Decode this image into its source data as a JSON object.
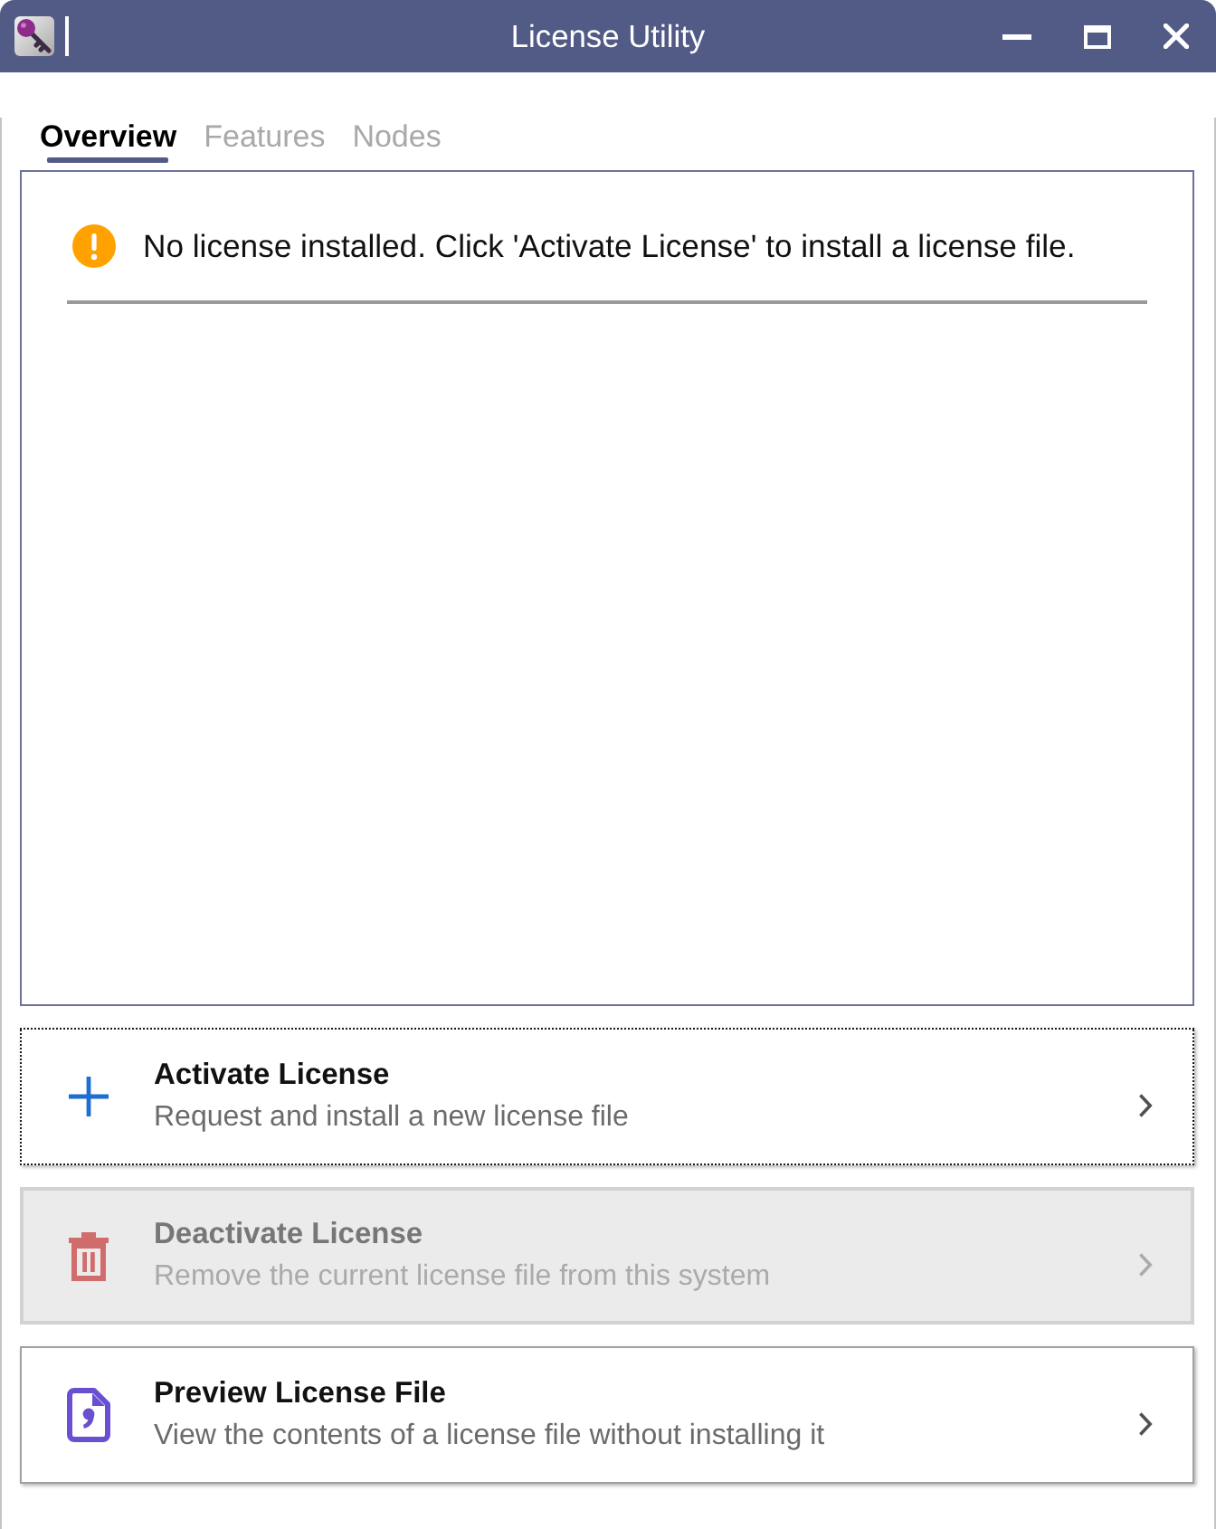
{
  "window": {
    "title": "License Utility"
  },
  "tabs": [
    {
      "label": "Overview",
      "selected": true
    },
    {
      "label": "Features",
      "selected": false
    },
    {
      "label": "Nodes",
      "selected": false
    }
  ],
  "overview": {
    "message": {
      "kind": "warning",
      "text": "No license installed. Click 'Activate License' to install a license file."
    }
  },
  "actions": [
    {
      "kind": "add",
      "title": "Activate License",
      "description": "Request and install a new license file",
      "focused": true,
      "disabled": false
    },
    {
      "kind": "delete",
      "title": "Deactivate License",
      "description": "Remove the current license file from this system",
      "focused": false,
      "disabled": true
    },
    {
      "kind": "preview",
      "title": "Preview License File",
      "description": "View the contents of a license file without installing it",
      "focused": false,
      "disabled": false
    }
  ]
}
